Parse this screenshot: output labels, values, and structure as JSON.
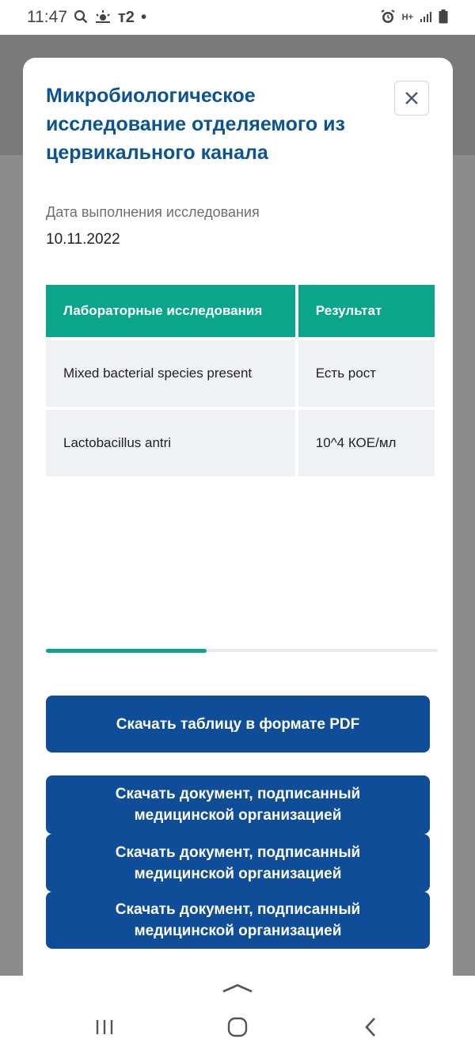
{
  "status_bar": {
    "time": "11:47",
    "carrier": "т2",
    "dot": "•",
    "network": "H+"
  },
  "modal": {
    "title": "Микробиологическое исследование отделяемого из цервикального канала",
    "date_label": "Дата выполнения исследования",
    "date_value": "10.11.2022",
    "table": {
      "headers": [
        "Лабораторные исследования",
        "Результат"
      ],
      "rows": [
        [
          "Mixed bacterial species present",
          "Есть рост"
        ],
        [
          "Lactobacillus antri",
          "10^4 КОЕ/мл"
        ]
      ]
    },
    "scroll_progress": 0.41,
    "buttons": {
      "pdf": "Скачать таблицу в формате PDF",
      "signed_1": "Скачать документ, подписанный медицинской организацией",
      "signed_2": "Скачать документ, подписанный медицинской организацией",
      "signed_3": "Скачать документ, подписанный медицинской организацией"
    }
  },
  "colors": {
    "title": "#0b5394",
    "header_bg": "#0aa58a",
    "button_bg": "#0f4d99",
    "cell_bg": "#eff1f5"
  }
}
